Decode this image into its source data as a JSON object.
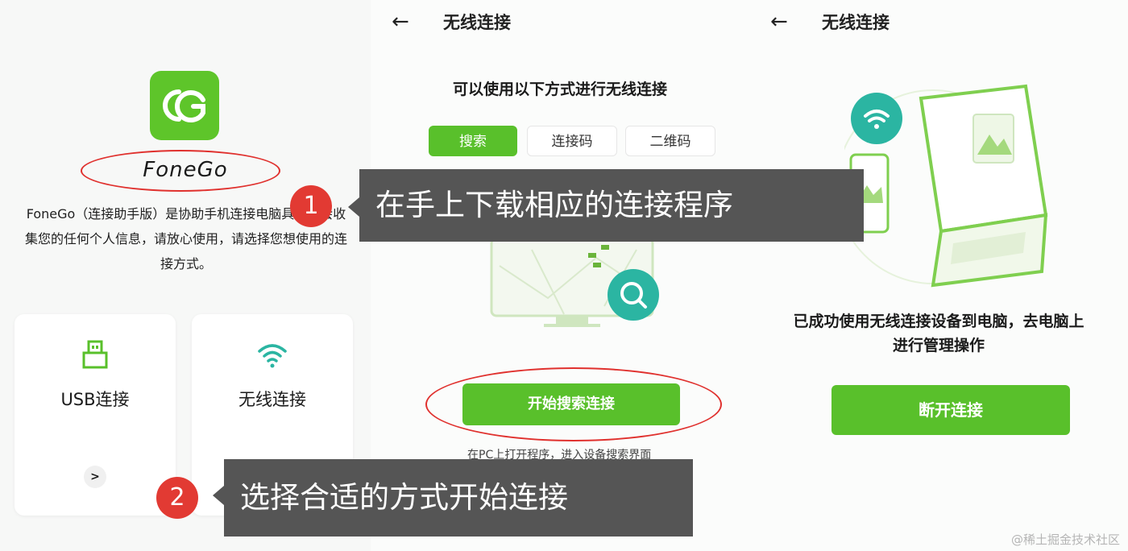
{
  "panel1": {
    "brand": "FoneGo",
    "description": "FoneGo（连接助手版）是协助手机连接电脑具，不会收集您的任何个人信息，请放心使用，请选择您想使用的连接方式。",
    "cards": [
      {
        "label": "USB连接",
        "arrow": ">"
      },
      {
        "label": "无线连接",
        "arrow": ">"
      }
    ]
  },
  "panel2": {
    "back": "←",
    "title": "无线连接",
    "subtitle": "可以使用以下方式进行无线连接",
    "tabs": [
      "搜索",
      "连接码",
      "二维码"
    ],
    "button": "开始搜索连接",
    "hint": "在PC上打开程序，进入设备搜索界面"
  },
  "panel3": {
    "back": "←",
    "title": "无线连接",
    "message_line1": "已成功使用无线连接设备到电脑，去电脑上",
    "message_line2": "进行管理操作",
    "button": "断开连接"
  },
  "callouts": [
    {
      "num": "1",
      "text": "在手上下载相应的连接程序"
    },
    {
      "num": "2",
      "text": "选择合适的方式开始连接"
    }
  ],
  "watermark": "@稀土掘金技术社区",
  "colors": {
    "accent": "#59c02b",
    "callout_bg": "#555555",
    "badge": "#e23a33",
    "ring": "#e0312e",
    "teal": "#2bb5a2"
  }
}
